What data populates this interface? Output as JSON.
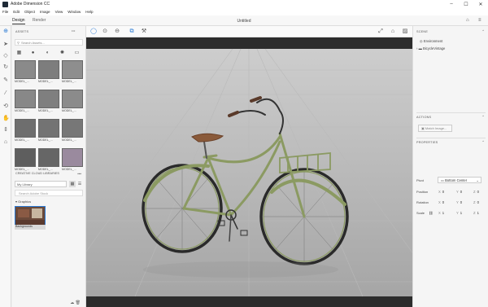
{
  "titlebar": {
    "title": "Adobe Dimension CC",
    "minimize": "–",
    "maximize": "☐",
    "close": "✕"
  },
  "menu": [
    "File",
    "Edit",
    "Object",
    "Image",
    "View",
    "Window",
    "Help"
  ],
  "modes": {
    "design": "Design",
    "render": "Render"
  },
  "document": {
    "title": "Untitled"
  },
  "assets": {
    "header": "ASSETS",
    "menu_dots": "•••",
    "search_placeholder": "Search Assets...",
    "models": [
      "MODEL_...",
      "MODEL_...",
      "MODEL_...",
      "MODEL_...",
      "MODEL_...",
      "MODEL_...",
      "MODEL_...",
      "MODEL_...",
      "MODEL_...",
      "MODEL_...",
      "MODEL_...",
      "MODEL_..."
    ],
    "cc_libraries_header": "CREATIVE CLOUD LIBRARIES",
    "library_selected": "My Library",
    "library_search_placeholder": "Search Adobe Stock",
    "graphics_label": "Graphics",
    "graphic_name": "Backgrounds"
  },
  "scene": {
    "header": "SCENE",
    "items": [
      "Environment",
      "BicycleVintage"
    ]
  },
  "actions": {
    "header": "ACTIONS",
    "match_image": "Match Image..."
  },
  "properties": {
    "header": "PROPERTIES",
    "pivot_label": "Pivot",
    "pivot_value": "Bottom Center",
    "position_label": "Position",
    "position": {
      "x": "0",
      "y": "0",
      "z": "0"
    },
    "rotation_label": "Rotation",
    "rotation": {
      "x": "0",
      "y": "0",
      "z": "0"
    },
    "scale_label": "Scale",
    "scale": {
      "x": "1",
      "y": "1",
      "z": "1"
    }
  },
  "colors": {
    "accent": "#2a7ad4",
    "bike_frame": "#8b9a62",
    "saddle": "#8a5a3a",
    "floor": "#a8a8a8"
  },
  "icons": [
    "select-icon",
    "orbit-icon",
    "pan-icon",
    "zoom-icon",
    "magic-wand-icon",
    "eyedropper-icon",
    "hand-icon",
    "camera-icon"
  ]
}
